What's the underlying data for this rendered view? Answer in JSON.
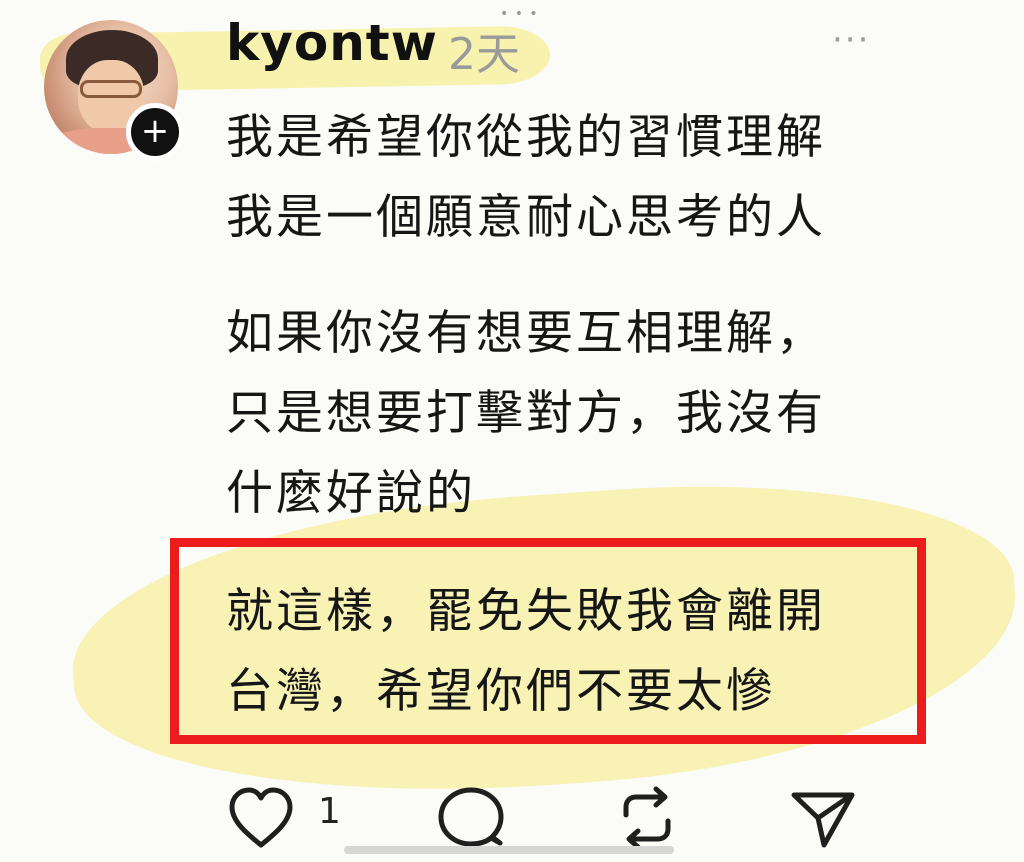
{
  "post": {
    "username": "kyontw",
    "time": "2天",
    "more_label": "···",
    "follow_label": "+",
    "lines": [
      "我是希望你從我的習慣理解",
      "我是一個願意耐心思考的人",
      "如果你沒有想要互相理解，",
      "只是想要打擊對方，我沒有",
      "什麼好說的",
      "就這樣，罷免失敗我會離開",
      "台灣，希望你們不要太慘"
    ],
    "highlight_color": "#ec1c1c",
    "marker_color": "#f6f1a2"
  },
  "actions": {
    "like_count": "1",
    "icons": [
      "heart-icon",
      "comment-icon",
      "repost-icon",
      "share-icon"
    ]
  },
  "top_handle": "• • •"
}
